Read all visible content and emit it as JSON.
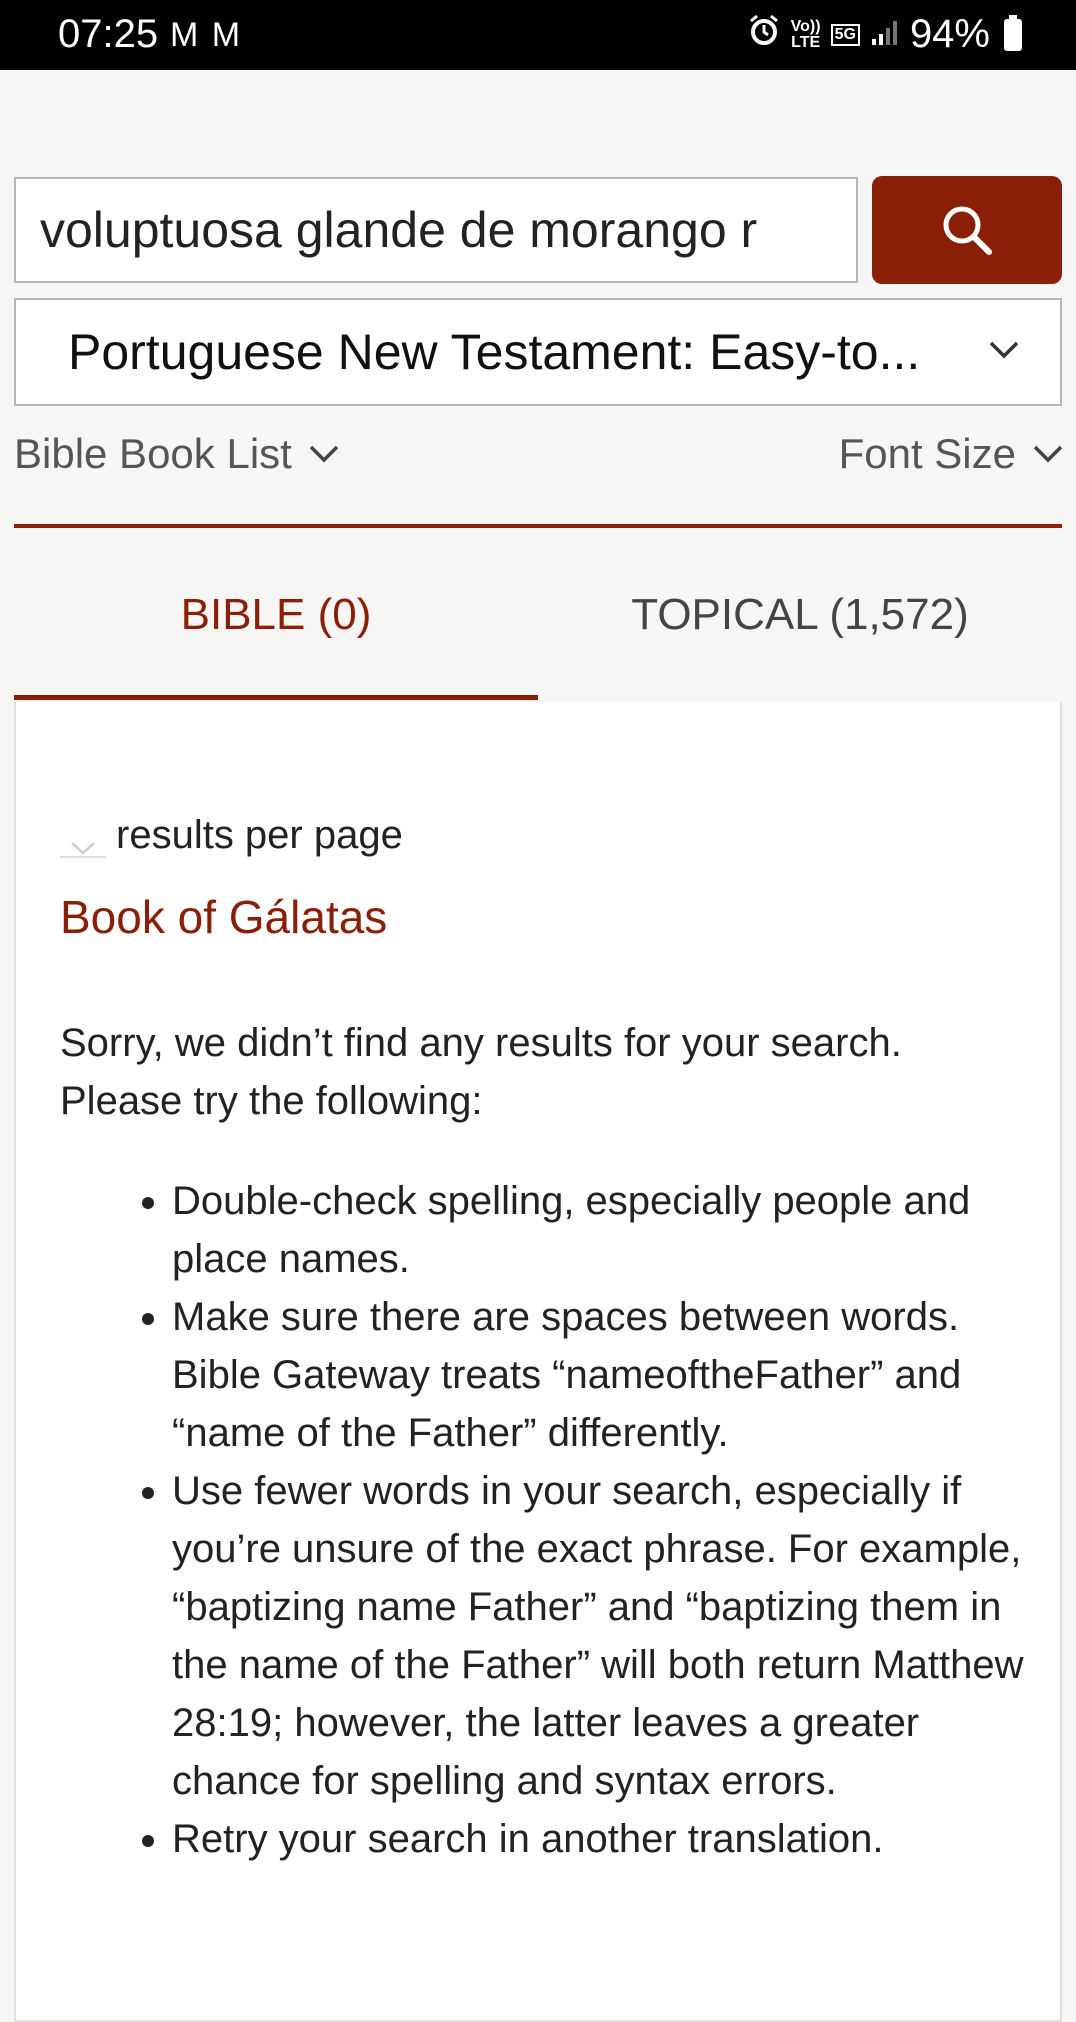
{
  "status_bar": {
    "time": "07:25",
    "mail_icons": "M M",
    "network_label_top": "Vo))",
    "network_label_bottom": "LTE",
    "five_g": "5G",
    "battery": "94%"
  },
  "search": {
    "query": "voluptuosa glande de morango r"
  },
  "version_select": {
    "label": "Portuguese New Testament: Easy-to..."
  },
  "controls": {
    "book_list": "Bible Book List",
    "font_size": "Font Size"
  },
  "tabs": {
    "bible": "BIBLE (0)",
    "topical": "TOPICAL (1,572)"
  },
  "results": {
    "per_page_label": "results per page",
    "book_heading": "Book of Gálatas",
    "sorry": "Sorry, we didn’t find any results for your search. Please try the following:",
    "tips": [
      "Double-check spelling, especially people and place names.",
      "Make sure there are spaces between words. Bible Gateway treats “nameoftheFather” and “name of the Father” differently.",
      "Use fewer words in your search, especially if you’re unsure of the exact phrase. For example, “baptizing name Father” and “baptizing them in the name of the Father” will both return Matthew 28:19; however, the latter leaves a greater chance for spelling and syntax errors.",
      "Retry your search in another translation."
    ]
  },
  "colors": {
    "accent": "#8a1e06",
    "background": "#f8f6f4"
  }
}
